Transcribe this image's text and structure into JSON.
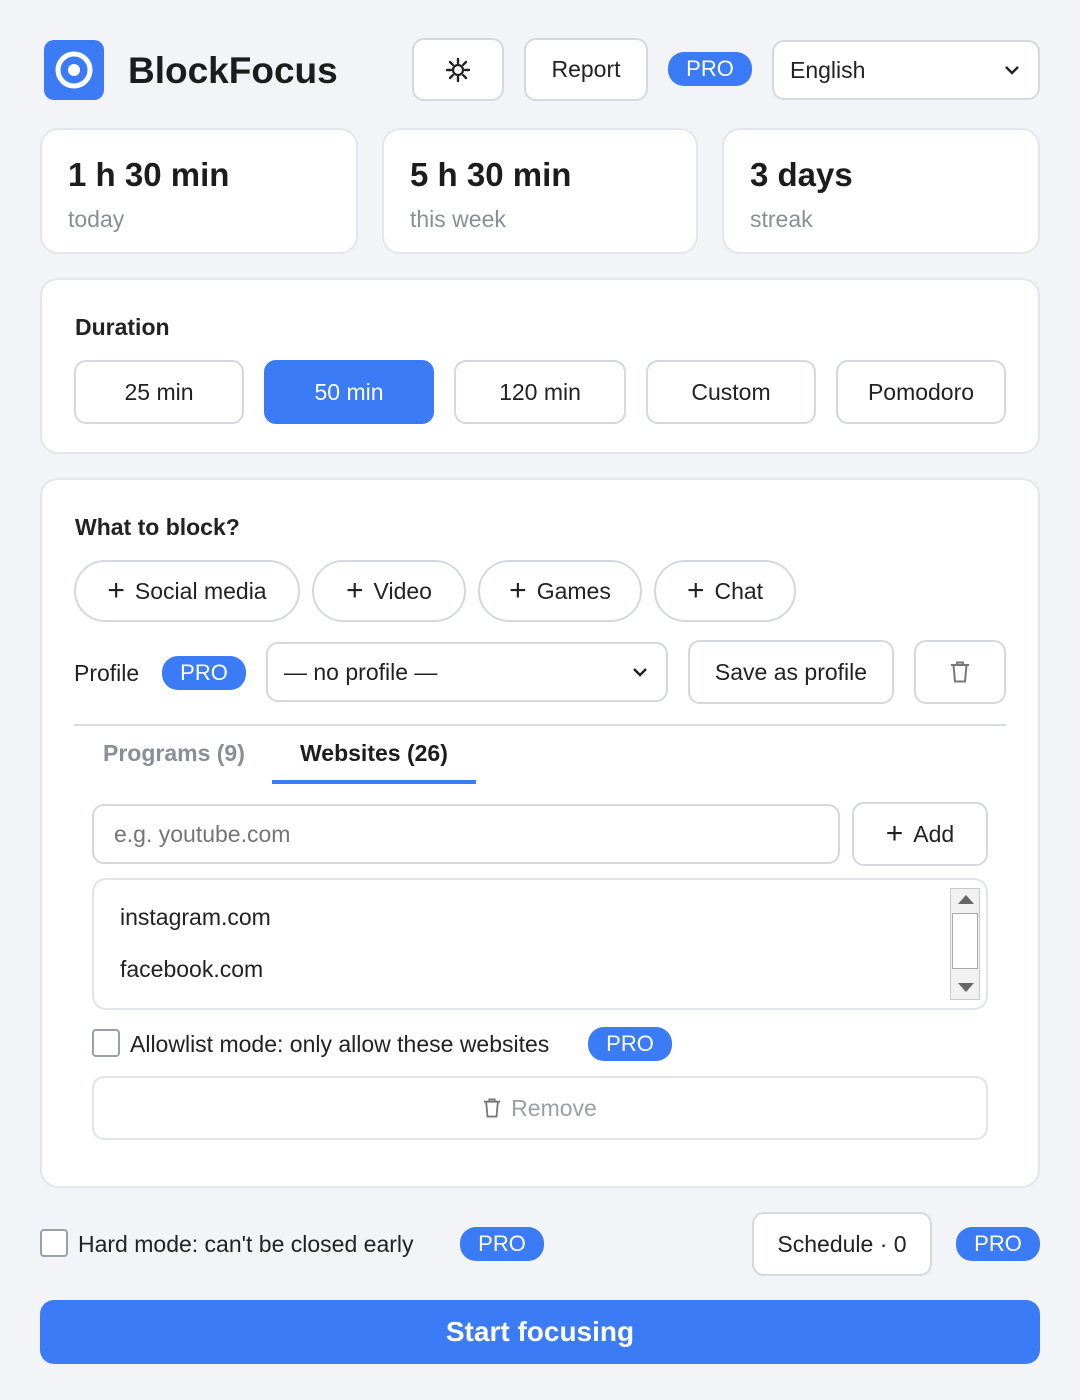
{
  "app": {
    "title": "BlockFocus",
    "logo_icon": "target-icon",
    "accent": "#3b7cf6"
  },
  "header": {
    "settings_icon": "gear-icon",
    "report_label": "Report",
    "pro_label": "PRO",
    "language": {
      "selected": "English",
      "icon": "chevron-down-icon"
    }
  },
  "stats": [
    {
      "value": "1 h 30 min",
      "label": "today"
    },
    {
      "value": "5 h 30 min",
      "label": "this week"
    },
    {
      "value": "3 days",
      "label": "streak"
    }
  ],
  "duration": {
    "title": "Duration",
    "options": [
      "25 min",
      "50 min",
      "120 min",
      "Custom",
      "Pomodoro"
    ],
    "selected": "50 min"
  },
  "block": {
    "title": "What to block?",
    "categories": [
      {
        "plus": "+",
        "label": "Social media"
      },
      {
        "plus": "+",
        "label": "Video"
      },
      {
        "plus": "+",
        "label": "Games"
      },
      {
        "plus": "+",
        "label": "Chat"
      }
    ],
    "profile": {
      "label": "Profile",
      "pro": "PRO",
      "selected": "— no profile —",
      "save_label": "Save as profile",
      "delete_icon": "trash-icon"
    },
    "tabs": [
      {
        "label": "Programs (9)",
        "active": false
      },
      {
        "label": "Websites (26)",
        "active": true
      }
    ],
    "input": {
      "placeholder": "e.g. youtube.com",
      "value": ""
    },
    "add_button": {
      "plus": "+",
      "label": "Add"
    },
    "websites": [
      "instagram.com",
      "facebook.com"
    ],
    "allowlist": {
      "label": "Allowlist mode: only allow these websites",
      "checked": false,
      "pro": "PRO"
    },
    "remove_label": "Remove"
  },
  "footer": {
    "hard_mode": {
      "label": "Hard mode: can't be closed early",
      "checked": false,
      "pro": "PRO"
    },
    "schedule_label": "Schedule · 0",
    "schedule_pro": "PRO",
    "start_label": "Start focusing"
  }
}
